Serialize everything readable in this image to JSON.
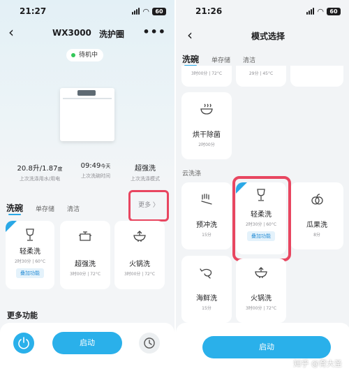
{
  "left": {
    "status": {
      "time": "21:27",
      "battery": "60"
    },
    "title": "WX3000",
    "title_link": "洗护圈",
    "more_icon": "more-dots-icon",
    "standby": "待机中",
    "stats": [
      {
        "value": "20.8升/1.87",
        "unit": "度",
        "label": "上次洗涤用水/用电"
      },
      {
        "value": "09:49",
        "unit": "今天",
        "label": "上次洗碗时间"
      },
      {
        "value": "超强洗",
        "unit": "",
        "label": "上次洗涤模式"
      }
    ],
    "tabs": [
      "洗碗",
      "单存储",
      "清洁"
    ],
    "more_button": "更多 〉",
    "cards": [
      {
        "name": "轻柔洗",
        "sub": "2时30分 | 60°C",
        "tag": "叠加功能"
      },
      {
        "name": "超强洗",
        "sub": "3时00分 | 72°C"
      },
      {
        "name": "火锅洗",
        "sub": "3时00分 | 72°C"
      }
    ],
    "more_functions": "更多功能",
    "start": "启动"
  },
  "right": {
    "status": {
      "time": "21:26",
      "battery": "60"
    },
    "title": "模式选择",
    "tabs": [
      "洗碗",
      "单存储",
      "清洁"
    ],
    "top_fragments": [
      "3时00分 | 72°C",
      "29分 | 45°C"
    ],
    "dry_card": {
      "name": "烘干除菌",
      "sub": "2时00分"
    },
    "cloud_section": "云洗涤",
    "cards": [
      {
        "name": "预冲洗",
        "sub": "15分"
      },
      {
        "name": "轻柔洗",
        "sub": "2时30分 | 60°C",
        "tag": "叠加功能"
      },
      {
        "name": "瓜果洗",
        "sub": "8分"
      },
      {
        "name": "海鲜洗",
        "sub": "15分"
      },
      {
        "name": "火锅洗",
        "sub": "3时00分 | 72°C"
      }
    ],
    "start": "启动",
    "watermark": "知乎 @育大圣"
  },
  "colors": {
    "accent": "#2ab0ea",
    "highlight": "#e84660",
    "tag_bg": "#e4f2fb"
  }
}
